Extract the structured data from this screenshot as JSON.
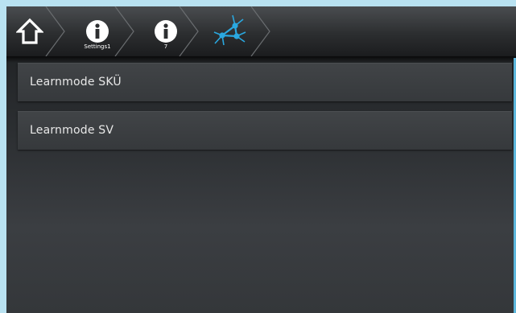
{
  "breadcrumb": {
    "home_icon": "home-icon",
    "items": [
      {
        "icon": "info-icon",
        "caption": "Settings1"
      },
      {
        "icon": "info-icon",
        "caption": "7"
      },
      {
        "icon": "network-nodes-icon",
        "caption": ""
      }
    ]
  },
  "list": {
    "items": [
      {
        "label": "Learnmode SKÜ"
      },
      {
        "label": "Learnmode SV"
      }
    ]
  },
  "colors": {
    "accent": "#2aa8e0",
    "frame": "#b9e2f1",
    "background": "#2b2e31",
    "text": "#e8e8e8"
  }
}
